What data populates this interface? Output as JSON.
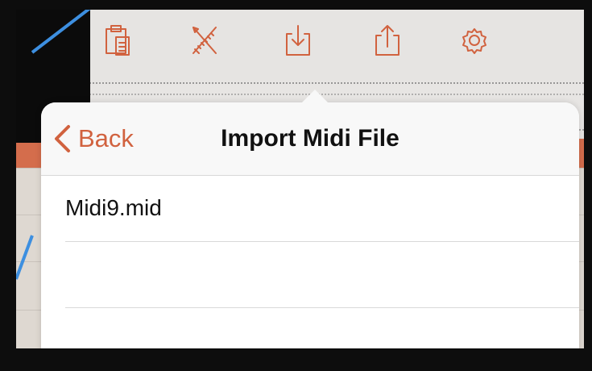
{
  "toolbar": {
    "icons": [
      "duplicate-icon",
      "clipboard-icon",
      "tools-icon",
      "import-icon",
      "share-icon",
      "settings-icon"
    ]
  },
  "popover": {
    "back_label": "Back",
    "title": "Import Midi File",
    "files": [
      "Midi9.mid",
      "",
      ""
    ]
  },
  "colors": {
    "accent": "#d1623f",
    "toolbar_bg": "#e6e4e2",
    "annotation": "#3d8fe0"
  }
}
